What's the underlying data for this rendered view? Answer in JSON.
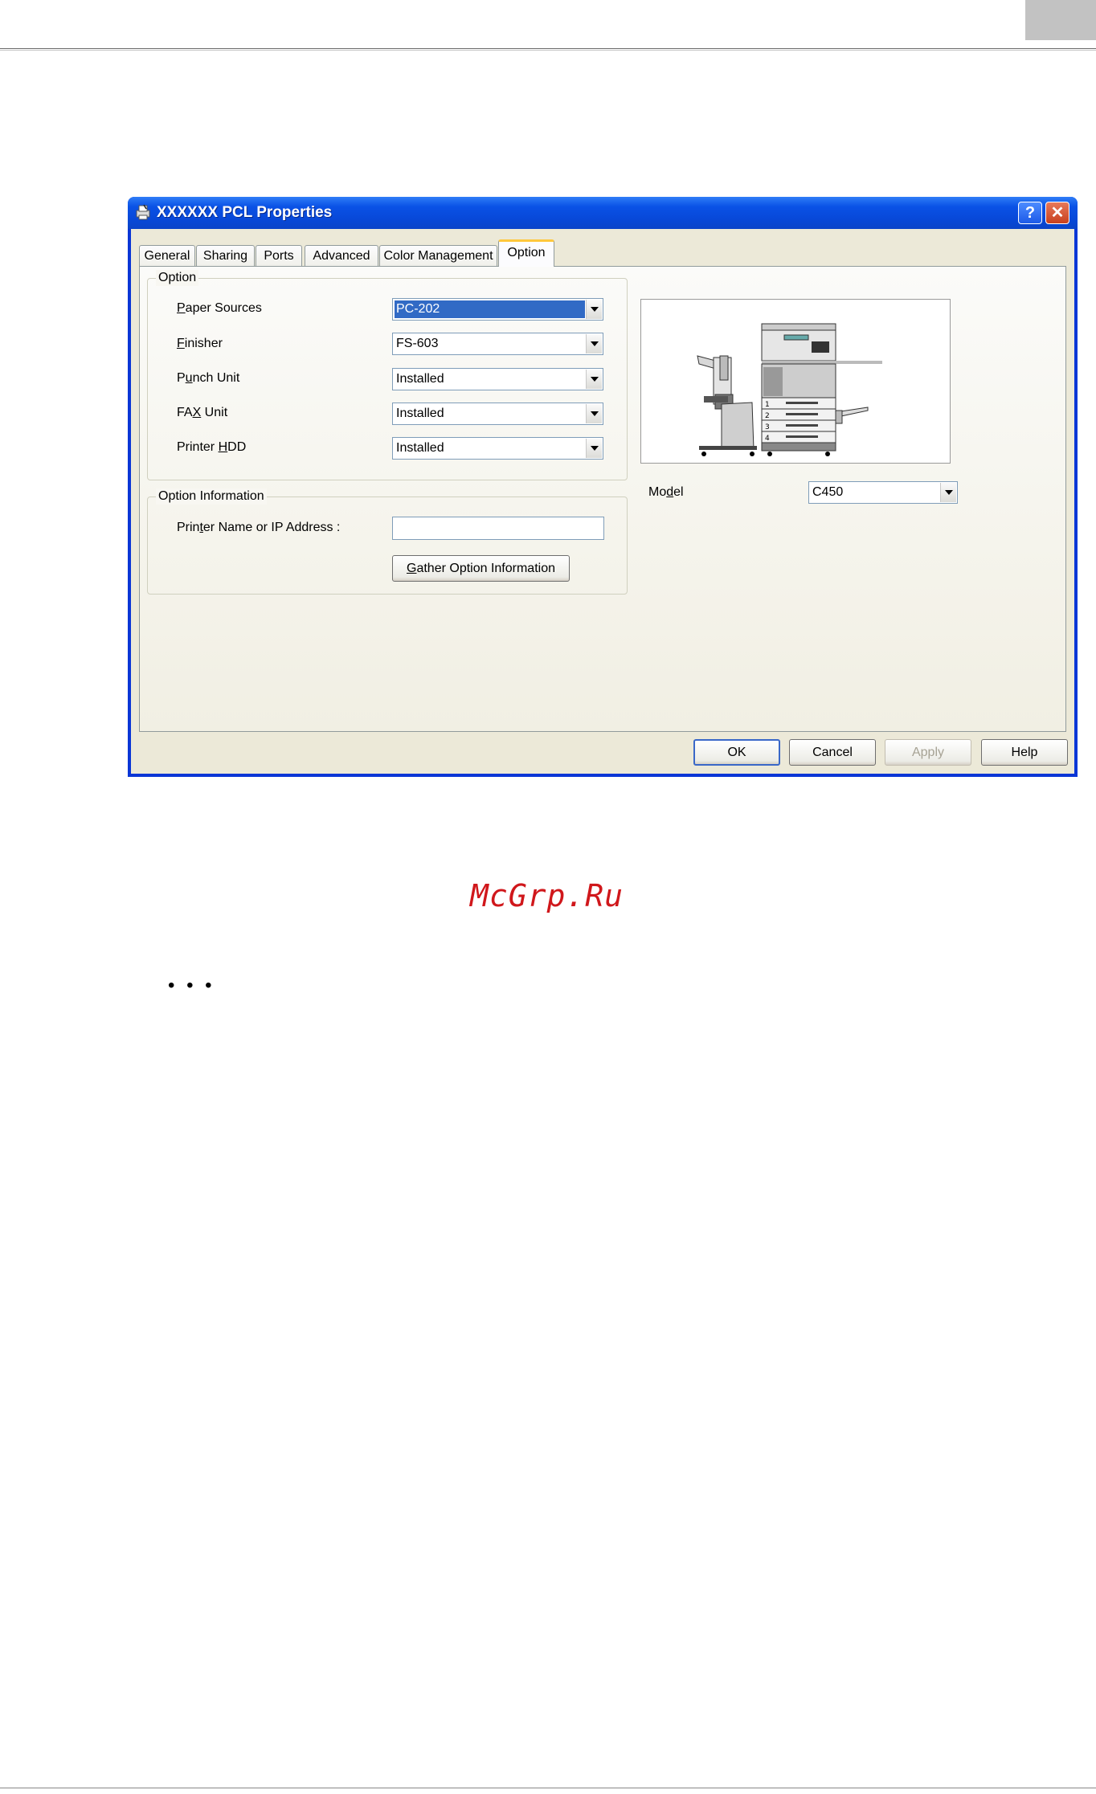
{
  "dialog": {
    "title": "XXXXXX PCL Properties",
    "help_button": "?",
    "close_button": "✕",
    "tabs": [
      {
        "label": "General"
      },
      {
        "label": "Sharing"
      },
      {
        "label": "Ports"
      },
      {
        "label": "Advanced"
      },
      {
        "label": "Color Management"
      },
      {
        "label": "Option",
        "active": true
      }
    ],
    "option_group": {
      "label": "Option",
      "fields": [
        {
          "label_pre": "",
          "label_key": "P",
          "label_post": "aper Sources",
          "value": "PC-202",
          "selected": true
        },
        {
          "label_pre": "",
          "label_key": "F",
          "label_post": "inisher",
          "value": "FS-603"
        },
        {
          "label_pre": "P",
          "label_key": "u",
          "label_post": "nch Unit",
          "value": "Installed"
        },
        {
          "label_pre": "FA",
          "label_key": "X",
          "label_post": " Unit",
          "value": "Installed"
        },
        {
          "label_pre": "Printer ",
          "label_key": "H",
          "label_post": "DD",
          "value": "Installed"
        }
      ]
    },
    "info_group": {
      "label": "Option Information",
      "printer_label_pre": "Prin",
      "printer_label_key": "t",
      "printer_label_post": "er Name or IP Address :",
      "printer_value": "",
      "gather_key": "G",
      "gather_rest": "ather Option Information"
    },
    "model": {
      "label_pre": "Mo",
      "label_key": "d",
      "label_post": "el",
      "value": "C450"
    },
    "tray_numbers": [
      "1",
      "2",
      "3",
      "4"
    ],
    "buttons": {
      "ok": "OK",
      "cancel": "Cancel",
      "apply": "Apply",
      "help": "Help"
    }
  },
  "watermark": "McGrp.Ru",
  "dots": "• • •"
}
